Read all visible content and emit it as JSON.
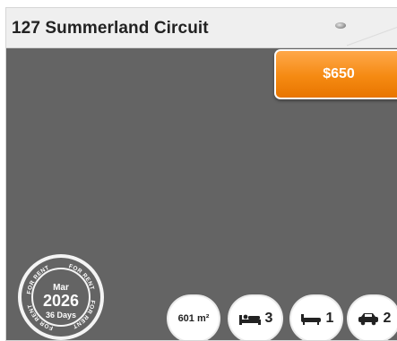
{
  "listing": {
    "address": "127 Summerland Circuit",
    "price": "$650",
    "stamp": {
      "label": "FOR RENT",
      "month": "Mar",
      "year": "2026",
      "days": "36 Days"
    },
    "features": {
      "land_area": "601 m²",
      "bedrooms": "3",
      "bathrooms": "1",
      "parking": "2"
    }
  },
  "icons": [
    "bed-icon",
    "bath-icon",
    "car-icon",
    "pin-icon"
  ],
  "colors": {
    "accent": "#f58a12",
    "background": "#646464"
  }
}
